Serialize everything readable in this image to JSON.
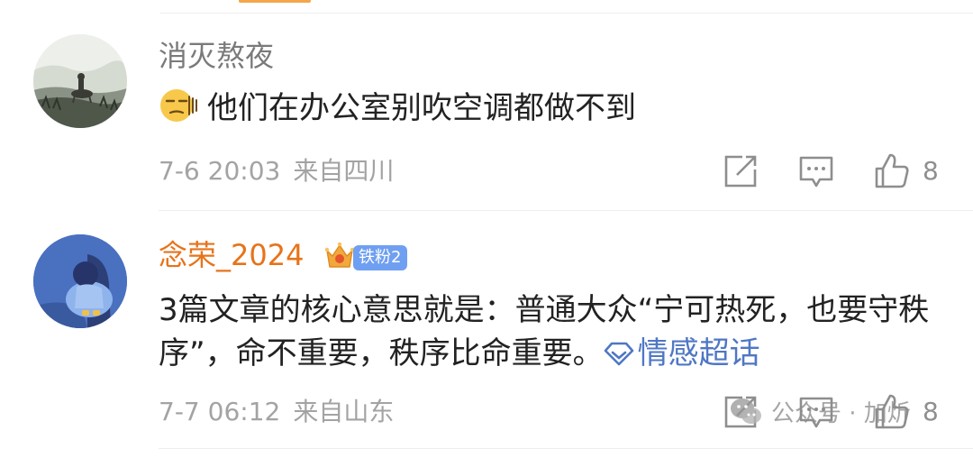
{
  "colors": {
    "username_gray": "#7a7a7a",
    "username_vip": "#e7731a",
    "meta_gray": "#a3a3a3",
    "link_blue": "#4f77c4",
    "fan_badge_bg": "#6f9ff1"
  },
  "comments": [
    {
      "avatar": "landscape-rider-avatar",
      "username": "消灭熬夜",
      "emoji": "smirk-emoji-icon",
      "text": "他们在办公室别吹空调都做不到",
      "time": "7-6 20:03",
      "location": "来自四川",
      "likes": "8"
    },
    {
      "avatar": "sitting-figure-avatar",
      "username": "念荣_2024",
      "crown": "crown-badge-icon",
      "fan_badge": "铁粉2",
      "text": "3篇文章的核心意思就是：普通大众“宁可热死，也要守秩序”，命不重要，秩序比命重要。",
      "topic_link": "情感超话",
      "time": "7-7 06:12",
      "location": "来自山东",
      "likes": "8"
    }
  ],
  "watermark": {
    "text": "公众号 · 加炘"
  }
}
